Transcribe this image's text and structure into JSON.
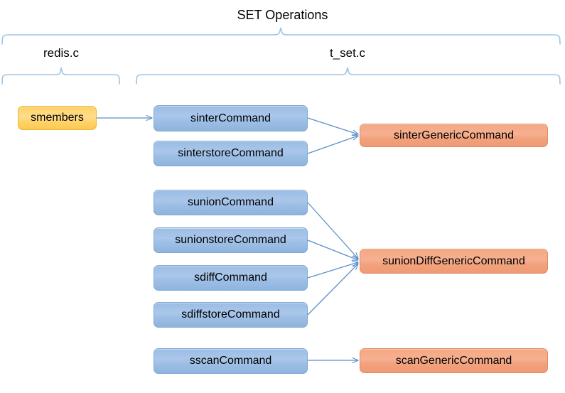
{
  "diagram": {
    "title": "SET Operations",
    "groups": [
      {
        "label": "redis.c"
      },
      {
        "label": "t_set.c"
      }
    ],
    "nodes": {
      "smembers": "smembers",
      "sinter_command": "sinterCommand",
      "sinterstore_command": "sinterstoreCommand",
      "sinter_generic_command": "sinterGenericCommand",
      "sunion_command": "sunionCommand",
      "sunionstore_command": "sunionstoreCommand",
      "sdiff_command": "sdiffCommand",
      "sdiffstore_command": "sdiffstoreCommand",
      "sunion_diff_generic_command": "sunionDiffGenericCommand",
      "sscan_command": "sscanCommand",
      "scan_generic_command": "scanGenericCommand"
    },
    "colors": {
      "blue_fill": "#a4c2e8",
      "blue_stroke": "#7ea7d4",
      "orange_fill": "#f4a883",
      "orange_stroke": "#e08b62",
      "yellow_fill": "#ffd164",
      "yellow_stroke": "#e8b63c",
      "connector": "#4a7ebb",
      "brace": "#9dc3e6",
      "text": "#000000",
      "background": "#ffffff"
    }
  }
}
